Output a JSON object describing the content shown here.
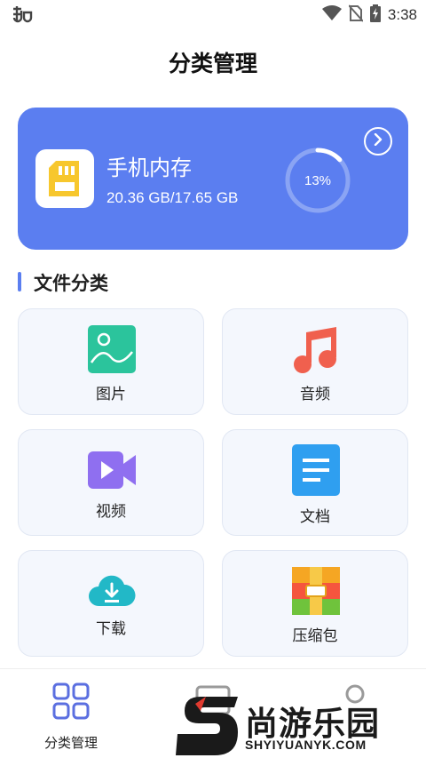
{
  "status_bar": {
    "time": "3:38",
    "icons": [
      "bug-icon",
      "wifi-icon",
      "no-sim-icon",
      "battery-charging-icon"
    ]
  },
  "header": {
    "title": "分类管理"
  },
  "storage": {
    "name": "手机内存",
    "size": "20.36 GB/17.65 GB",
    "percent_label": "13%",
    "percent": 13,
    "icon": "sd-card-icon",
    "colors": {
      "card": "#5b7ef0",
      "ring_track": "#8aa4f4",
      "ring_fill": "#ffffff"
    }
  },
  "section": {
    "title": "文件分类"
  },
  "categories": [
    {
      "label": "图片",
      "icon": "image-icon"
    },
    {
      "label": "音频",
      "icon": "music-icon"
    },
    {
      "label": "视频",
      "icon": "video-icon"
    },
    {
      "label": "文档",
      "icon": "document-icon"
    },
    {
      "label": "下载",
      "icon": "cloud-download-icon"
    },
    {
      "label": "压缩包",
      "icon": "archive-icon"
    }
  ],
  "bottom_nav": {
    "items": [
      {
        "label": "分类管理",
        "icon": "grid-icon",
        "active": true
      }
    ]
  },
  "watermark": {
    "title": "尚游乐园",
    "subtitle": "SHYIYUANYK.COM"
  }
}
